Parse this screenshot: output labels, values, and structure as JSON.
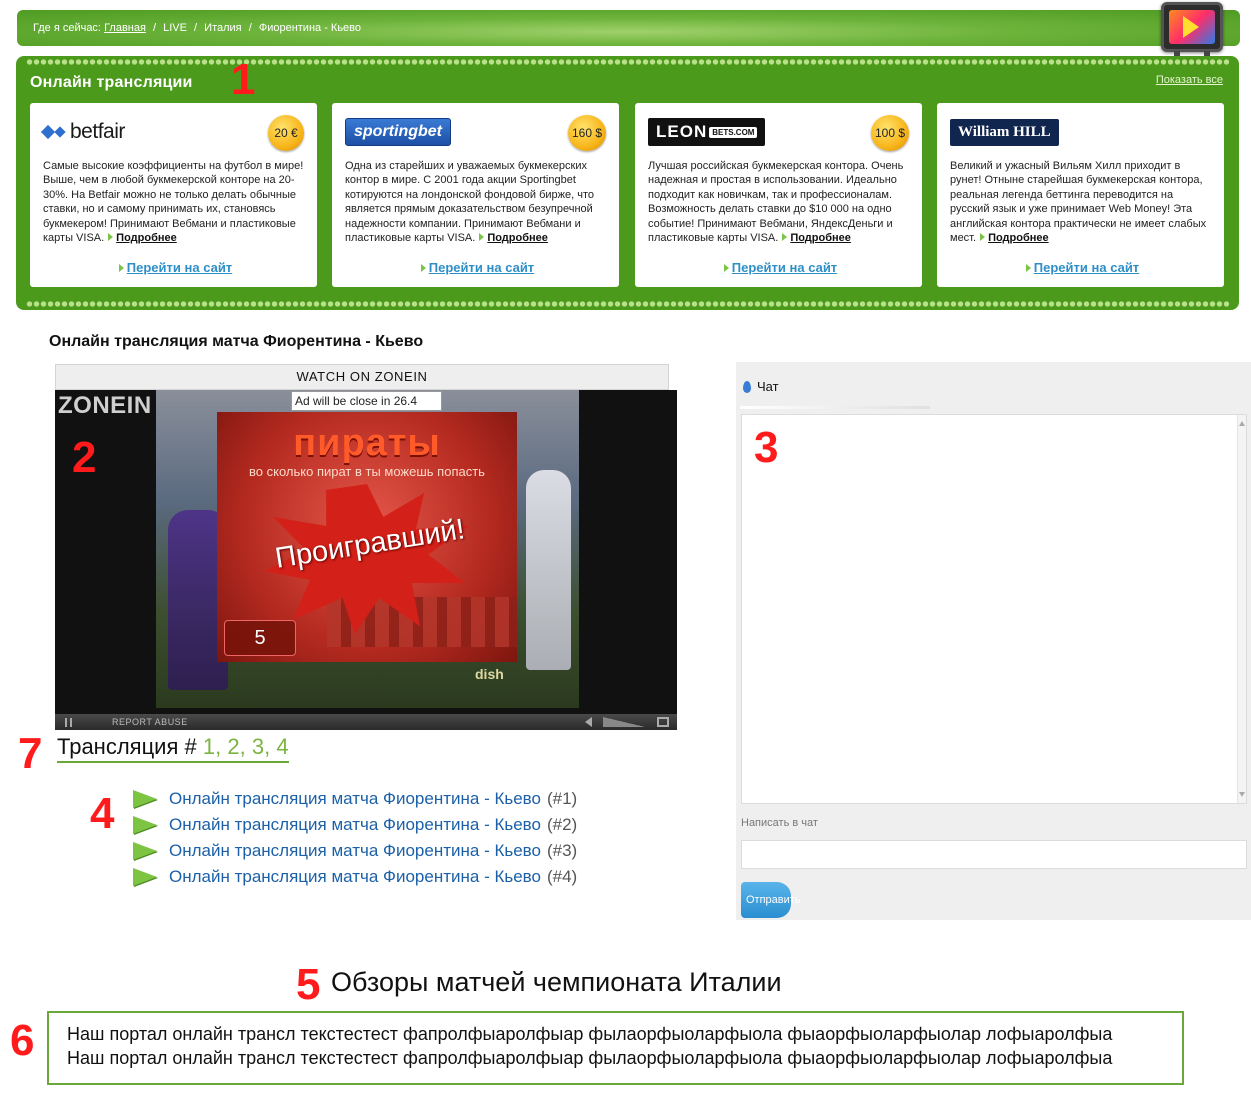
{
  "breadcrumb": {
    "prefix": "Где я сейчас:",
    "home": "Главная",
    "sep": "/",
    "items": [
      "LIVE",
      "Италия",
      "Фиорентина - Кьево"
    ]
  },
  "broadcasts_panel": {
    "title": "Онлайн трансляции",
    "show_all": "Показать все",
    "cards": [
      {
        "logo": "betfair",
        "bonus": "20 €",
        "text": "Самые высокие коэффициенты на футбол в мире! Выше, чем в любой букмекерской конторе на 20-30%. На Betfair можно не только делать обычные ставки, но и самому принимать их, становясь букмекером! Принимают Вебмани и пластиковые карты VISA.",
        "more": "Подробнее",
        "goto": "Перейти на сайт"
      },
      {
        "logo": "sportingbet",
        "bonus": "160 $",
        "text": "Одна из старейших и уважаемых букмекерских контор в мире. С 2001 года акции Sportingbet котируются на лондонской фондовой бирже, что является прямым доказательством безупречной надежности компании. Принимают Вебмани и пластиковые карты VISA.",
        "more": "Подробнее",
        "goto": "Перейти на сайт"
      },
      {
        "logo": "LEON",
        "logo_tag": "BETS.COM",
        "bonus": "100 $",
        "text": "Лучшая российская букмекерская контора. Очень надежная и простая в использовании. Идеально подходит как новичкам, так и профессионалам. Возможность делать ставки до $10 000 на одно событие! Принимают Вебмани, ЯндексДеньги и пластиковые карты VISA.",
        "more": "Подробнее",
        "goto": "Перейти на сайт"
      },
      {
        "logo": "William HILL",
        "bonus": "",
        "text": "Великий и ужасный Вильям Хилл приходит в рунет! Отныне старейшая букмекерская контора, реальная легенда беттинга переводится на русский язык и уже принимает Web Money! Эта английская контора практически не имеет слабых мест.",
        "more": "Подробнее",
        "goto": "Перейти на сайт"
      }
    ]
  },
  "match_title": "Онлайн трансляция матча Фиорентина - Кьево",
  "player": {
    "header": "WATCH ON ZONEIN",
    "logo": "ZONEIN",
    "ad_close": "Ad will be close in 26.4",
    "ad_title": "пираты",
    "ad_sub": "во сколько пират в ты можешь попасть",
    "ad_loser": "Проигравший!",
    "ad_count": "5",
    "channel": "dish",
    "report": "REPORT ABUSE"
  },
  "chat": {
    "title": "Чат",
    "input_label": "Написать в чат",
    "send": "Отправить"
  },
  "broadcast": {
    "label": "Трансляция #",
    "numbers": [
      "1",
      "2",
      "3",
      "4"
    ],
    "links": [
      {
        "text": "Онлайн трансляция матча Фиорентина - Кьево",
        "num": "(#1)"
      },
      {
        "text": "Онлайн трансляция матча Фиорентина - Кьево",
        "num": "(#2)"
      },
      {
        "text": "Онлайн трансляция матча Фиорентина - Кьево",
        "num": "(#3)"
      },
      {
        "text": "Онлайн трансляция матча Фиорентина - Кьево",
        "num": "(#4)"
      }
    ]
  },
  "reviews_title": "Обзоры матчей чемпионата Италии",
  "seo_text": [
    "Наш портал онлайн трансл текстестест фапролфыаролфыар фылаорфыоларфыола фыаорфыоларфыолар лофыаролфыа",
    "Наш портал онлайн трансл текстестест фапролфыаролфыар фылаорфыоларфыола фыаорфыоларфыолар лофыаролфыа"
  ],
  "annotations": [
    "1",
    "2",
    "3",
    "4",
    "5",
    "6",
    "7"
  ],
  "colors": {
    "panel_green": "#4c9a1c",
    "link_blue": "#2e8fc8",
    "annotation_red": "#ff1b1b",
    "accent_green": "#7cb441"
  },
  "icons": [
    "tv-icon",
    "play-icon",
    "betfair-diamond-icon",
    "bullet-triangle-icon",
    "chat-pin-icon",
    "arrow-right-icon"
  ]
}
